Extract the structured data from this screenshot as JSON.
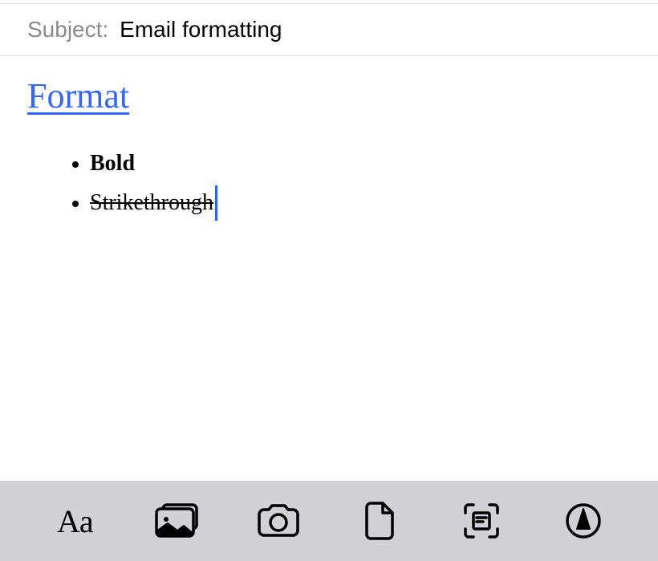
{
  "subject": {
    "label": "Subject:",
    "value": "Email formatting"
  },
  "body": {
    "heading": "Format",
    "list_items": {
      "item0": "Bold",
      "item1": "Strikethrough"
    }
  },
  "toolbar": {
    "text_style": "Aa"
  }
}
